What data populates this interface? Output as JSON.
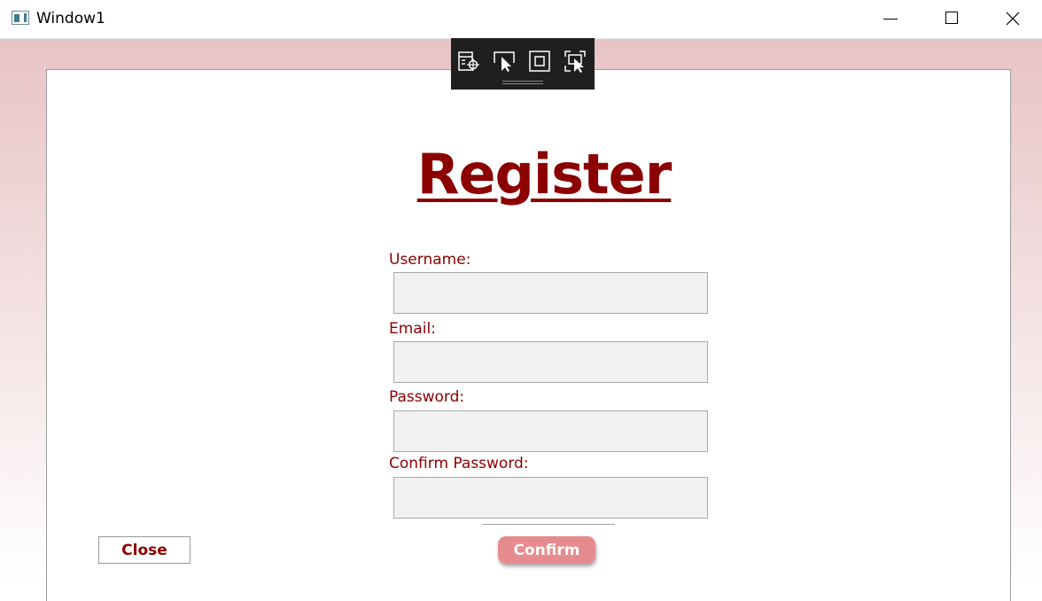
{
  "window": {
    "title": "Window1",
    "controls": {
      "minimize_icon": "minimize-icon",
      "maximize_icon": "maximize-icon",
      "close_icon": "close-icon"
    }
  },
  "debug_toolbar": {
    "icons": [
      "live-visual-tree-icon",
      "select-element-icon",
      "display-layout-adorners-icon",
      "track-focused-element-icon"
    ]
  },
  "form": {
    "heading": "Register",
    "username_label": "Username:",
    "username_value": "",
    "email_label": "Email:",
    "email_value": "",
    "password_label": "Password:",
    "password_value": "",
    "confirm_password_label": "Confirm Password:",
    "confirm_password_value": ""
  },
  "buttons": {
    "close_label": "Close",
    "confirm_label": "Confirm"
  },
  "colors": {
    "accent": "#8b0000",
    "confirm_button": "#e68b8e",
    "field_background": "#f1f1f1",
    "gradient_top": "#e8c3c4"
  }
}
